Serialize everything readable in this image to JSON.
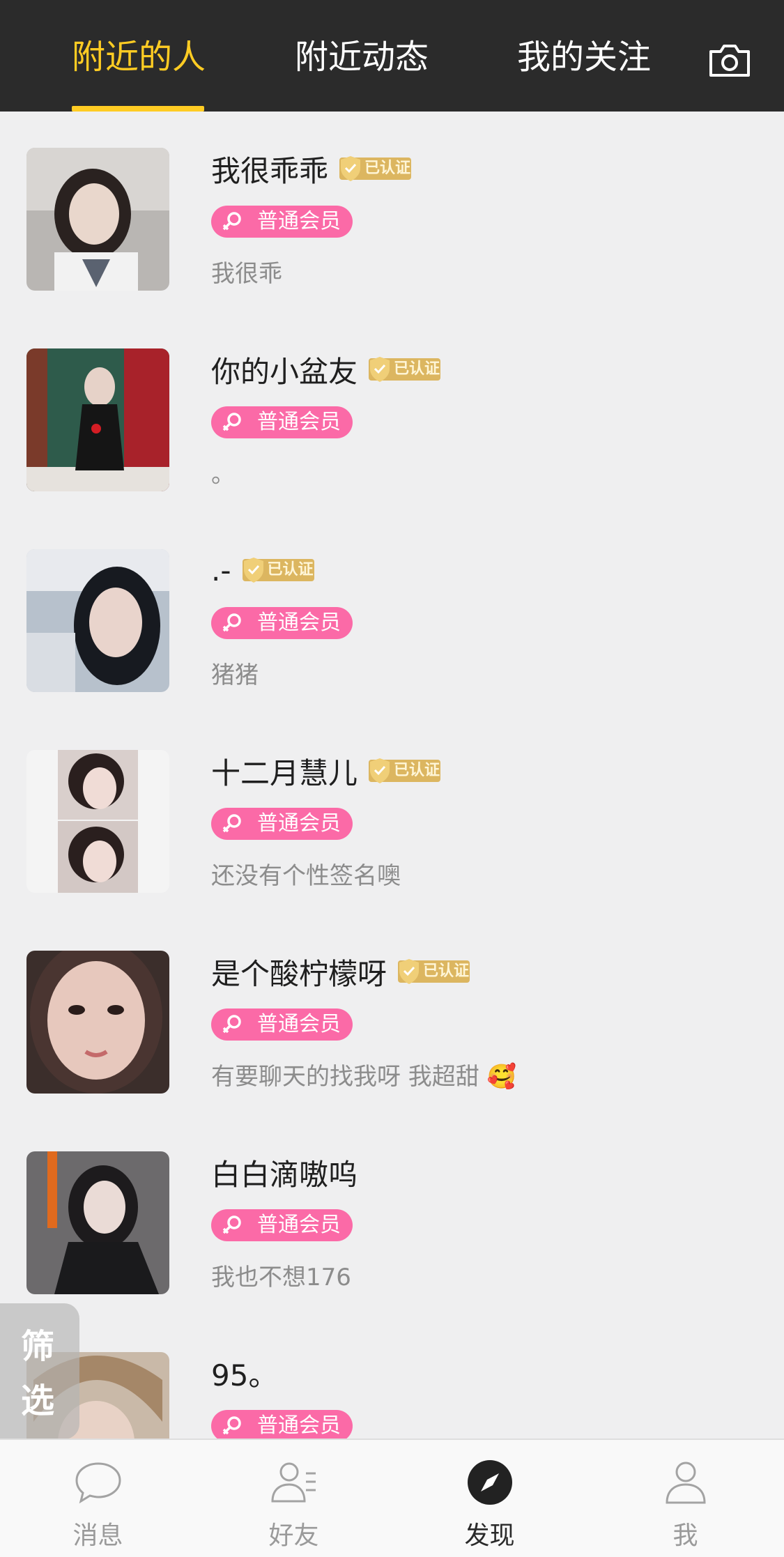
{
  "header": {
    "tabs": [
      {
        "label": "附近的人",
        "active": true
      },
      {
        "label": "附近动态",
        "active": false
      },
      {
        "label": "我的关注",
        "active": false
      }
    ],
    "camera_icon": "camera-icon",
    "accent_color": "#ffcc23"
  },
  "users": [
    {
      "name": "我很乖乖",
      "verified": true,
      "badge_text": "已认证",
      "member": "普通会员",
      "signature": "我很乖"
    },
    {
      "name": "你的小盆友",
      "verified": true,
      "badge_text": "已认证",
      "member": "普通会员",
      "signature": "。"
    },
    {
      "name": ".-",
      "verified": true,
      "badge_text": "已认证",
      "member": "普通会员",
      "signature": "猪猪"
    },
    {
      "name": "十二月慧儿",
      "verified": true,
      "badge_text": "已认证",
      "member": "普通会员",
      "signature": "还没有个性签名噢"
    },
    {
      "name": "是个酸柠檬呀",
      "verified": true,
      "badge_text": "已认证",
      "member": "普通会员",
      "signature": "有要聊天的找我呀 我超甜 🥰"
    },
    {
      "name": "白白滴嗷呜",
      "verified": false,
      "member": "普通会员",
      "signature": "我也不想176"
    },
    {
      "name": "95。",
      "verified": false,
      "member": "普通会员",
      "signature": ""
    }
  ],
  "member_color": "#fb6aa7",
  "filter_button": {
    "line1": "筛",
    "line2": "选"
  },
  "bottom_nav": [
    {
      "label": "消息",
      "icon": "chat-bubble-icon",
      "active": false
    },
    {
      "label": "好友",
      "icon": "friends-icon",
      "active": false
    },
    {
      "label": "发现",
      "icon": "compass-icon",
      "active": true
    },
    {
      "label": "我",
      "icon": "person-icon",
      "active": false
    }
  ]
}
